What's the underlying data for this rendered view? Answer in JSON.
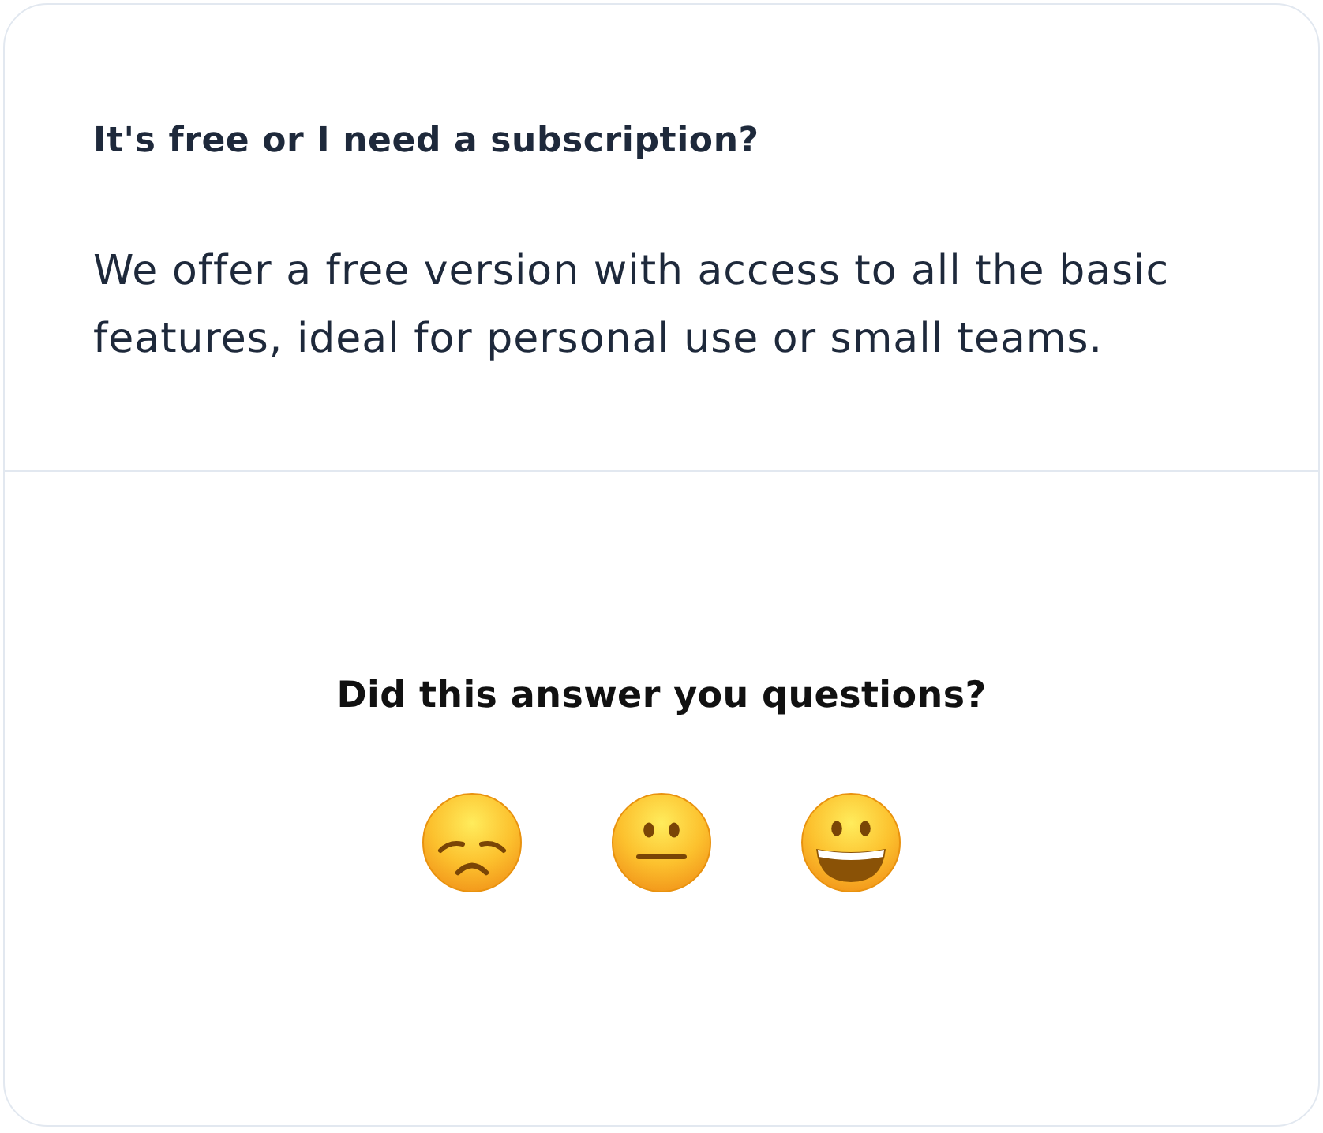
{
  "faq": {
    "question": "It's free or I need a subscription?",
    "answer": "We offer a free version with access to all the basic features, ideal for personal use or small teams."
  },
  "feedback": {
    "prompt": "Did this answer you questions?",
    "options": [
      {
        "kind": "sad",
        "selected": false
      },
      {
        "kind": "neutral",
        "selected": false
      },
      {
        "kind": "happy",
        "selected": false
      }
    ]
  }
}
